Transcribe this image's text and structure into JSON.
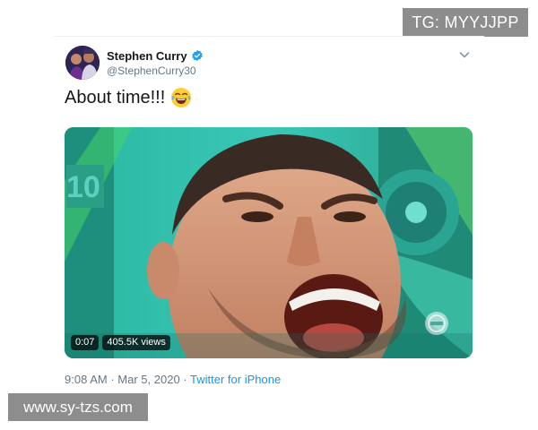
{
  "watermarks": {
    "top": "TG: MYYJJPP",
    "bottom": "www.sy-tzs.com"
  },
  "tweet": {
    "author": {
      "display_name": "Stephen Curry",
      "handle": "@StephenCurry30",
      "verified": true,
      "avatar_icon": "profile-photo"
    },
    "text": "About time!!!",
    "emoji_icon": "face-with-tears-of-joy-icon",
    "media": {
      "kind": "video",
      "duration": "0:07",
      "views": "405.5K views"
    },
    "time": "9:08 AM",
    "separator": "·",
    "date": "Mar 5, 2020",
    "source": "Twitter for iPhone",
    "menu_icon": "chevron-down-icon"
  },
  "colors": {
    "text": "#14171a",
    "secondary_text": "#657786",
    "link": "#1b95e0",
    "verified_badge": "#1da1f2",
    "watermark_bg": "#8d8d8d"
  }
}
